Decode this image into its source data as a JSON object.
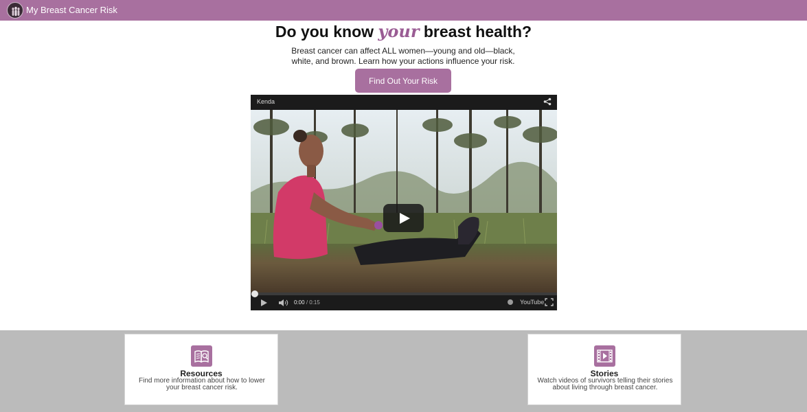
{
  "header": {
    "site_title": "My Breast Cancer Risk",
    "logo_icon": "silhouettes-logo-icon",
    "background_color": "#a8709f"
  },
  "hero": {
    "headline_before": "Do you know",
    "headline_emphasis": "your",
    "headline_after": "breast health?",
    "intro_line1": "Breast cancer can affect ALL women—young and old—black,",
    "intro_line2": "white, and brown. Learn how your actions influence your risk.",
    "cta_label": "Find Out Your Risk",
    "accent_color": "#a8709f"
  },
  "video": {
    "title": "Kenda",
    "current_time": "0:00",
    "duration": "/ 0:15",
    "progress": 0,
    "branding": "YouTube",
    "icons": [
      "share-icon",
      "play-icon",
      "volume-icon",
      "info-icon",
      "youtube-logo-icon",
      "fullscreen-icon"
    ]
  },
  "cards": [
    {
      "title": "Resources",
      "description": "Find more information about how to lower your breast cancer risk.",
      "icon": "book-icon"
    },
    {
      "title": "Stories",
      "description": "Watch videos of survivors telling their stories about living through breast cancer.",
      "icon": "film-icon"
    }
  ]
}
